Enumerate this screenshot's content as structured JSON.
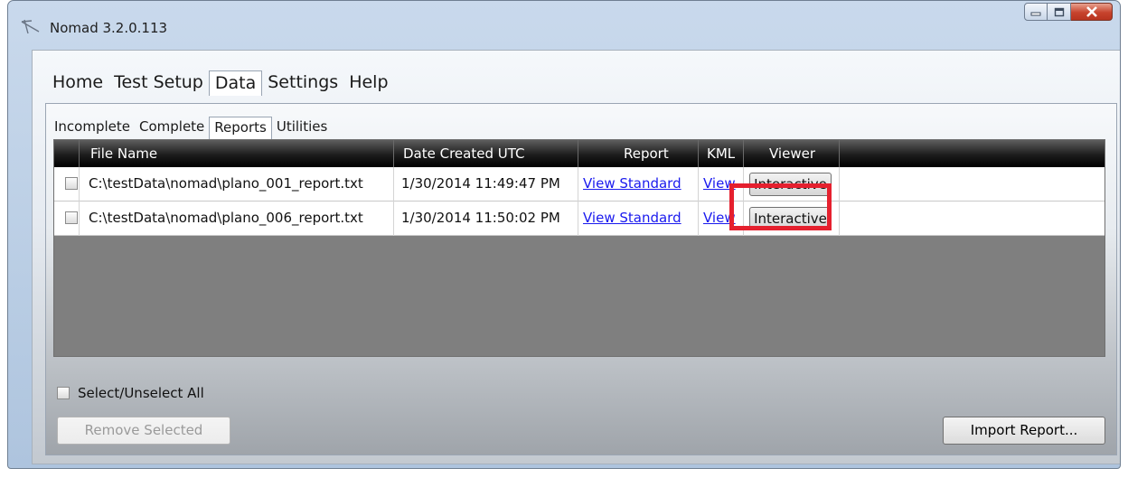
{
  "window": {
    "title": "Nomad 3.2.0.113",
    "icons": [
      "nomad-app-icon",
      "minimize-icon",
      "maximize-icon",
      "close-icon"
    ]
  },
  "main_tabs": [
    {
      "label": "Home",
      "active": false
    },
    {
      "label": "Test Setup",
      "active": false
    },
    {
      "label": "Data",
      "active": true
    },
    {
      "label": "Settings",
      "active": false
    },
    {
      "label": "Help",
      "active": false
    }
  ],
  "sub_tabs": [
    {
      "label": "Incomplete",
      "active": false
    },
    {
      "label": "Complete",
      "active": false
    },
    {
      "label": "Reports",
      "active": true
    },
    {
      "label": "Utilities",
      "active": false
    }
  ],
  "grid": {
    "columns": [
      "File Name",
      "Date Created UTC",
      "Report",
      "KML",
      "Viewer"
    ],
    "rows": [
      {
        "checked": false,
        "file_name": "C:\\testData\\nomad\\plano_001_report.txt",
        "date_created": "1/30/2014 11:49:47 PM",
        "report_link": "View Standard",
        "kml_link": "View",
        "viewer_button": "Interactive"
      },
      {
        "checked": false,
        "file_name": "C:\\testData\\nomad\\plano_006_report.txt",
        "date_created": "1/30/2014 11:50:02 PM",
        "report_link": "View Standard",
        "kml_link": "View",
        "viewer_button": "Interactive"
      }
    ]
  },
  "select_all": {
    "label": "Select/Unselect All",
    "checked": false
  },
  "buttons": {
    "remove_selected": {
      "label": "Remove Selected",
      "enabled": false
    },
    "import_report": {
      "label": "Import Report...",
      "enabled": true
    }
  },
  "colors": {
    "highlight": "#e5202e",
    "link": "#1a1aee",
    "header": "#000000",
    "grid_empty": "#7f7f7f"
  }
}
